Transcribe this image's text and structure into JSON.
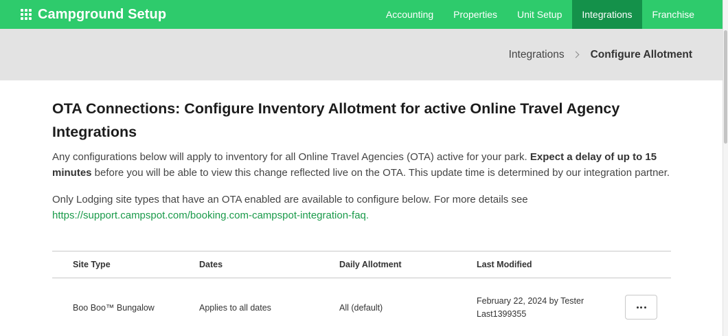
{
  "app": {
    "title": "Campground Setup"
  },
  "nav": {
    "items": [
      {
        "label": "Accounting"
      },
      {
        "label": "Properties"
      },
      {
        "label": "Unit Setup"
      },
      {
        "label": "Integrations",
        "active": true
      },
      {
        "label": "Franchise"
      }
    ]
  },
  "breadcrumb": {
    "parent": "Integrations",
    "current": "Configure Allotment"
  },
  "page": {
    "heading": "OTA Connections: Configure Inventory Allotment for active Online Travel Agency Integrations",
    "intro_before": "Any configurations below will apply to inventory for all Online Travel Agencies (OTA) active for your park. ",
    "intro_bold": "Expect a delay of up to 15 minutes",
    "intro_after": " before you will be able to view this change reflected live on the OTA. This update time is determined by our integration partner.",
    "note": "Only Lodging site types that have an OTA enabled are available to configure below. For more details see",
    "link": "https://support.campspot.com/booking.com-campspot-integration-faq."
  },
  "table": {
    "headers": {
      "site_type": "Site Type",
      "dates": "Dates",
      "daily_allotment": "Daily Allotment",
      "last_modified": "Last Modified"
    },
    "rows": [
      {
        "site_type": "Boo Boo™ Bungalow",
        "dates": "Applies to all dates",
        "daily_allotment": "All (default)",
        "last_modified": "February 22, 2024 by Tester Last1399355"
      }
    ]
  },
  "icons": {
    "app_menu": "grid-icon",
    "breadcrumb_separator": "chevron-right-icon",
    "row_actions": "more-horizontal-icon"
  },
  "colors": {
    "topbar": "#2ecb6c",
    "nav_active": "#14914a",
    "link": "#1a9a4a",
    "breadcrumb_bar": "#e3e3e3"
  }
}
